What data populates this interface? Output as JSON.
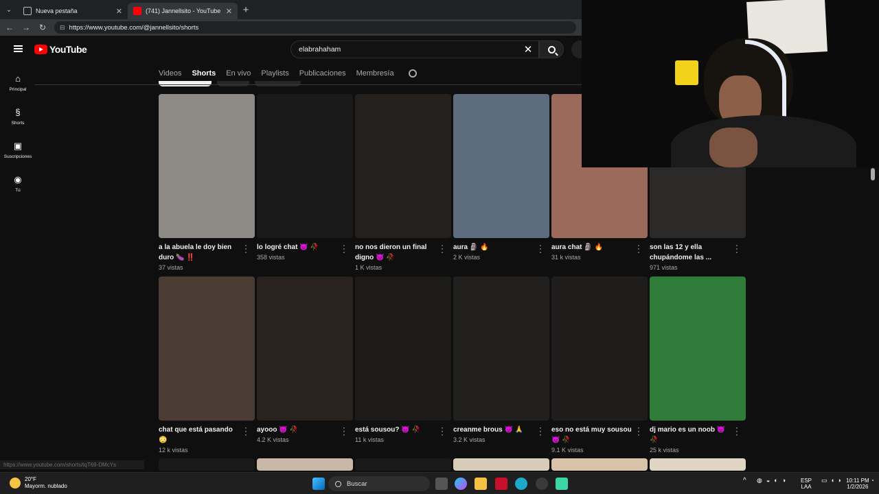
{
  "browser": {
    "tabs": [
      {
        "title": "Nueva pestaña",
        "active": false
      },
      {
        "title": "(741) Jannellsito - YouTube",
        "active": true
      }
    ],
    "url": "https://www.youtube.com/@jannellsito/shorts",
    "status_url": "https://www.youtube.com/shorts/tqT69-DMcYs"
  },
  "youtube": {
    "logo_text": "YouTube",
    "search_value": "elabrahaham",
    "sidebar": [
      {
        "label": "Principal",
        "icon": "home-icon"
      },
      {
        "label": "Shorts",
        "icon": "shorts-icon"
      },
      {
        "label": "Suscripciones",
        "icon": "subscriptions-icon"
      },
      {
        "label": "Tú",
        "icon": "you-icon"
      }
    ],
    "channel_tabs": [
      "Videos",
      "Shorts",
      "En vivo",
      "Playlists",
      "Publicaciones",
      "Membresía"
    ],
    "active_tab": "Shorts"
  },
  "shorts": [
    {
      "title": "a la abuela le doy bien duro 🍆 ‼️",
      "views": "37 vistas",
      "bg": "#8d8a86"
    },
    {
      "title": "lo logré chat 😈 🥀",
      "views": "358 vistas",
      "bg": "#1a1a1a"
    },
    {
      "title": "no nos dieron un final digno 😈 🥀",
      "views": "1 K vistas",
      "bg": "#23201e"
    },
    {
      "title": "aura 🗿 🔥",
      "views": "2 K vistas",
      "bg": "#5d6c7e"
    },
    {
      "title": "aura chat 🗿 🔥",
      "views": "31 k vistas",
      "bg": "#9b6a5a"
    },
    {
      "title": "son las 12 y ella chupándome las ...",
      "views": "971 vistas",
      "bg": "#2c2a28"
    },
    {
      "title": "chat que está pasando 😳",
      "views": "12 k vistas",
      "bg": "#4a3c32"
    },
    {
      "title": "ayooo 😈 🥀",
      "views": "4.2 K vistas",
      "bg": "#2a221f"
    },
    {
      "title": "está sousou? 😈 🥀",
      "views": "11 k vistas",
      "bg": "#1d1b1a"
    },
    {
      "title": "creanme brous 😈 🙏",
      "views": "3.2 K vistas",
      "bg": "#22201f"
    },
    {
      "title": "eso no está muy sousou 😈 🥀",
      "views": "9.1 K vistas",
      "bg": "#1f1d1c"
    },
    {
      "title": "dj mario es un noob 😈 🥀",
      "views": "25 k vistas",
      "bg": "#2f7b3a"
    }
  ],
  "taskbar": {
    "weather_temp": "20°F",
    "weather_desc": "Mayorm. nublado",
    "search_placeholder": "Buscar",
    "lang_top": "ESP",
    "lang_bottom": "LAA",
    "time": "10:11 PM",
    "date": "1/2/2026"
  }
}
